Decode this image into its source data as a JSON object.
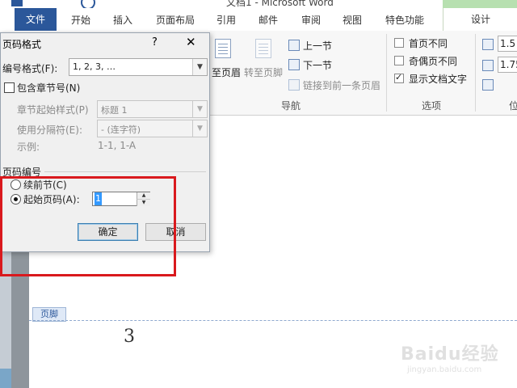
{
  "window": {
    "title": "文档1 - Microsoft Word"
  },
  "ribbon_tabs": {
    "file": "文件",
    "items": [
      "开始",
      "插入",
      "页面布局",
      "引用",
      "邮件",
      "审阅",
      "视图",
      "特色功能"
    ],
    "design": "设计"
  },
  "ribbon": {
    "goto_header": "至页眉",
    "goto_footer": "转至页脚",
    "prev_section": "上一节",
    "next_section": "下一节",
    "link_previous": "链接到前一条页眉",
    "nav_group": "导航",
    "options": {
      "different_first": "首页不同",
      "different_odd_even": "奇偶页不同",
      "show_doc_text": "显示文档文字",
      "group": "选项"
    },
    "position": {
      "header_from_top": "1.5",
      "footer_from_bottom": "1.75",
      "group": "位"
    }
  },
  "dialog": {
    "title": "页码格式",
    "help": "?",
    "close": "✕",
    "number_format_label": "编号格式(F):",
    "number_format_value": "1, 2, 3, …",
    "include_chapter_label": "包含章节号(N)",
    "chapter_style_label": "章节起始样式(P)",
    "chapter_style_value": "标题 1",
    "separator_label": "使用分隔符(E):",
    "separator_value": "-  (连字符)",
    "example_label": "示例:",
    "example_value": "1-1, 1-A",
    "page_numbering_label": "页码编号",
    "continue_label": "续前节(C)",
    "start_at_label": "起始页码(A):",
    "start_at_value": "1",
    "ok": "确定",
    "cancel": "取消"
  },
  "document": {
    "footer_tag": "页脚",
    "page_number": "3"
  },
  "watermark": {
    "text": "Baidu经验",
    "url": "jingyan.baidu.com"
  }
}
